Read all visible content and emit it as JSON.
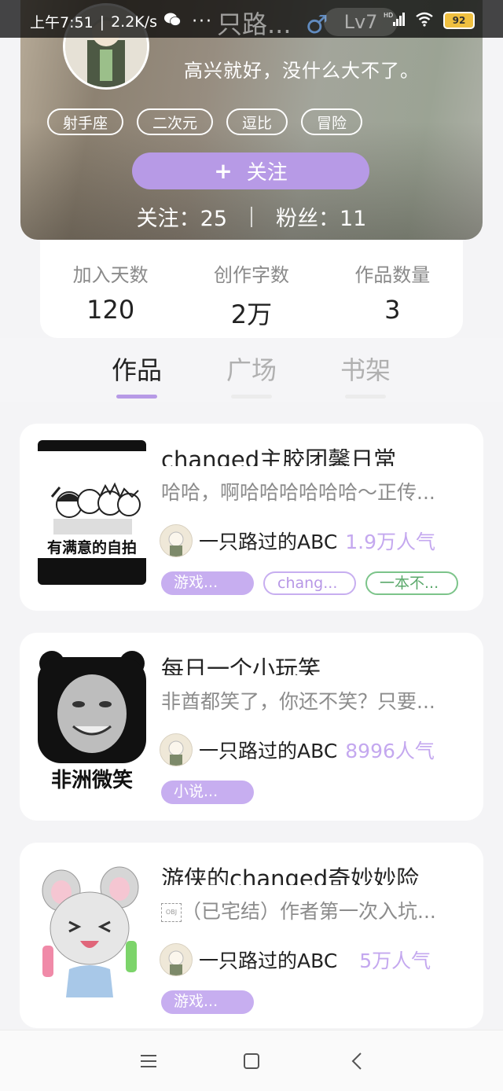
{
  "status_bar": {
    "time": "上午7:51",
    "speed": "2.2K/s",
    "battery": "92",
    "signal_label": "HD"
  },
  "profile": {
    "name_partial": "只路...",
    "gender_symbol": "♂",
    "level": "Lv7",
    "motto": "高兴就好，没什么大不了。",
    "tags": [
      "射手座",
      "二次元",
      "逗比",
      "冒险"
    ],
    "follow_button": "关注",
    "follow_plus": "+",
    "following": "关注：25",
    "followers": "粉丝：11"
  },
  "stats": [
    {
      "label": "加入天数",
      "value": "120"
    },
    {
      "label": "创作字数",
      "value": "2万"
    },
    {
      "label": "作品数量",
      "value": "3"
    }
  ],
  "tabs": [
    "作品",
    "广场",
    "书架"
  ],
  "works": [
    {
      "title": "changed主胶团馨日常",
      "desc": "哈哈，啊哈哈哈哈哈哈～正传...",
      "cover_caption": "有满意的自拍",
      "author": "一只路过的ABC",
      "popularity": "1.9万人气",
      "chips": [
        "游戏...",
        "chang...",
        "一本不..."
      ]
    },
    {
      "title": "每日一个小玩笑",
      "desc": "非酋都笑了，你还不笑？只要...",
      "cover_caption": "非洲微笑",
      "author": "一只路过的ABC",
      "popularity": "8996人气",
      "chips": [
        "小说..."
      ]
    },
    {
      "title": "游侠的changed奇妙妙险",
      "desc": "（已宅结）作者第一次入坑...",
      "obj_glyph": "OBJ",
      "author": "一只路过的ABC",
      "popularity": "5万人气",
      "chips": [
        "游戏..."
      ]
    }
  ]
}
